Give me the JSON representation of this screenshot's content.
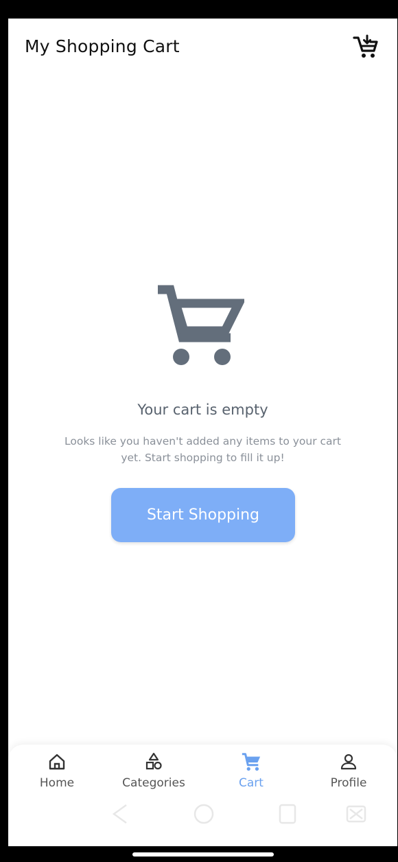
{
  "appbar": {
    "title": "My Shopping Cart",
    "action_icon": "add-to-cart-icon"
  },
  "empty_state": {
    "illustration_icon": "shopping-cart-icon",
    "title": "Your cart is empty",
    "subtitle": "Looks like you haven't added any items to your cart yet. Start shopping to fill it up!",
    "button_label": "Start Shopping"
  },
  "bottom_nav": {
    "items": [
      {
        "label": "Home",
        "icon": "home-icon",
        "active": false
      },
      {
        "label": "Categories",
        "icon": "categories-icon",
        "active": false
      },
      {
        "label": "Cart",
        "icon": "cart-icon",
        "active": true
      },
      {
        "label": "Profile",
        "icon": "profile-icon",
        "active": false
      }
    ]
  },
  "colors": {
    "accent": "#7eaef7",
    "active_nav": "#6aa1ef",
    "illustration": "#636e7b",
    "title_text": "#58626e",
    "subtitle_text": "#8a9099"
  }
}
